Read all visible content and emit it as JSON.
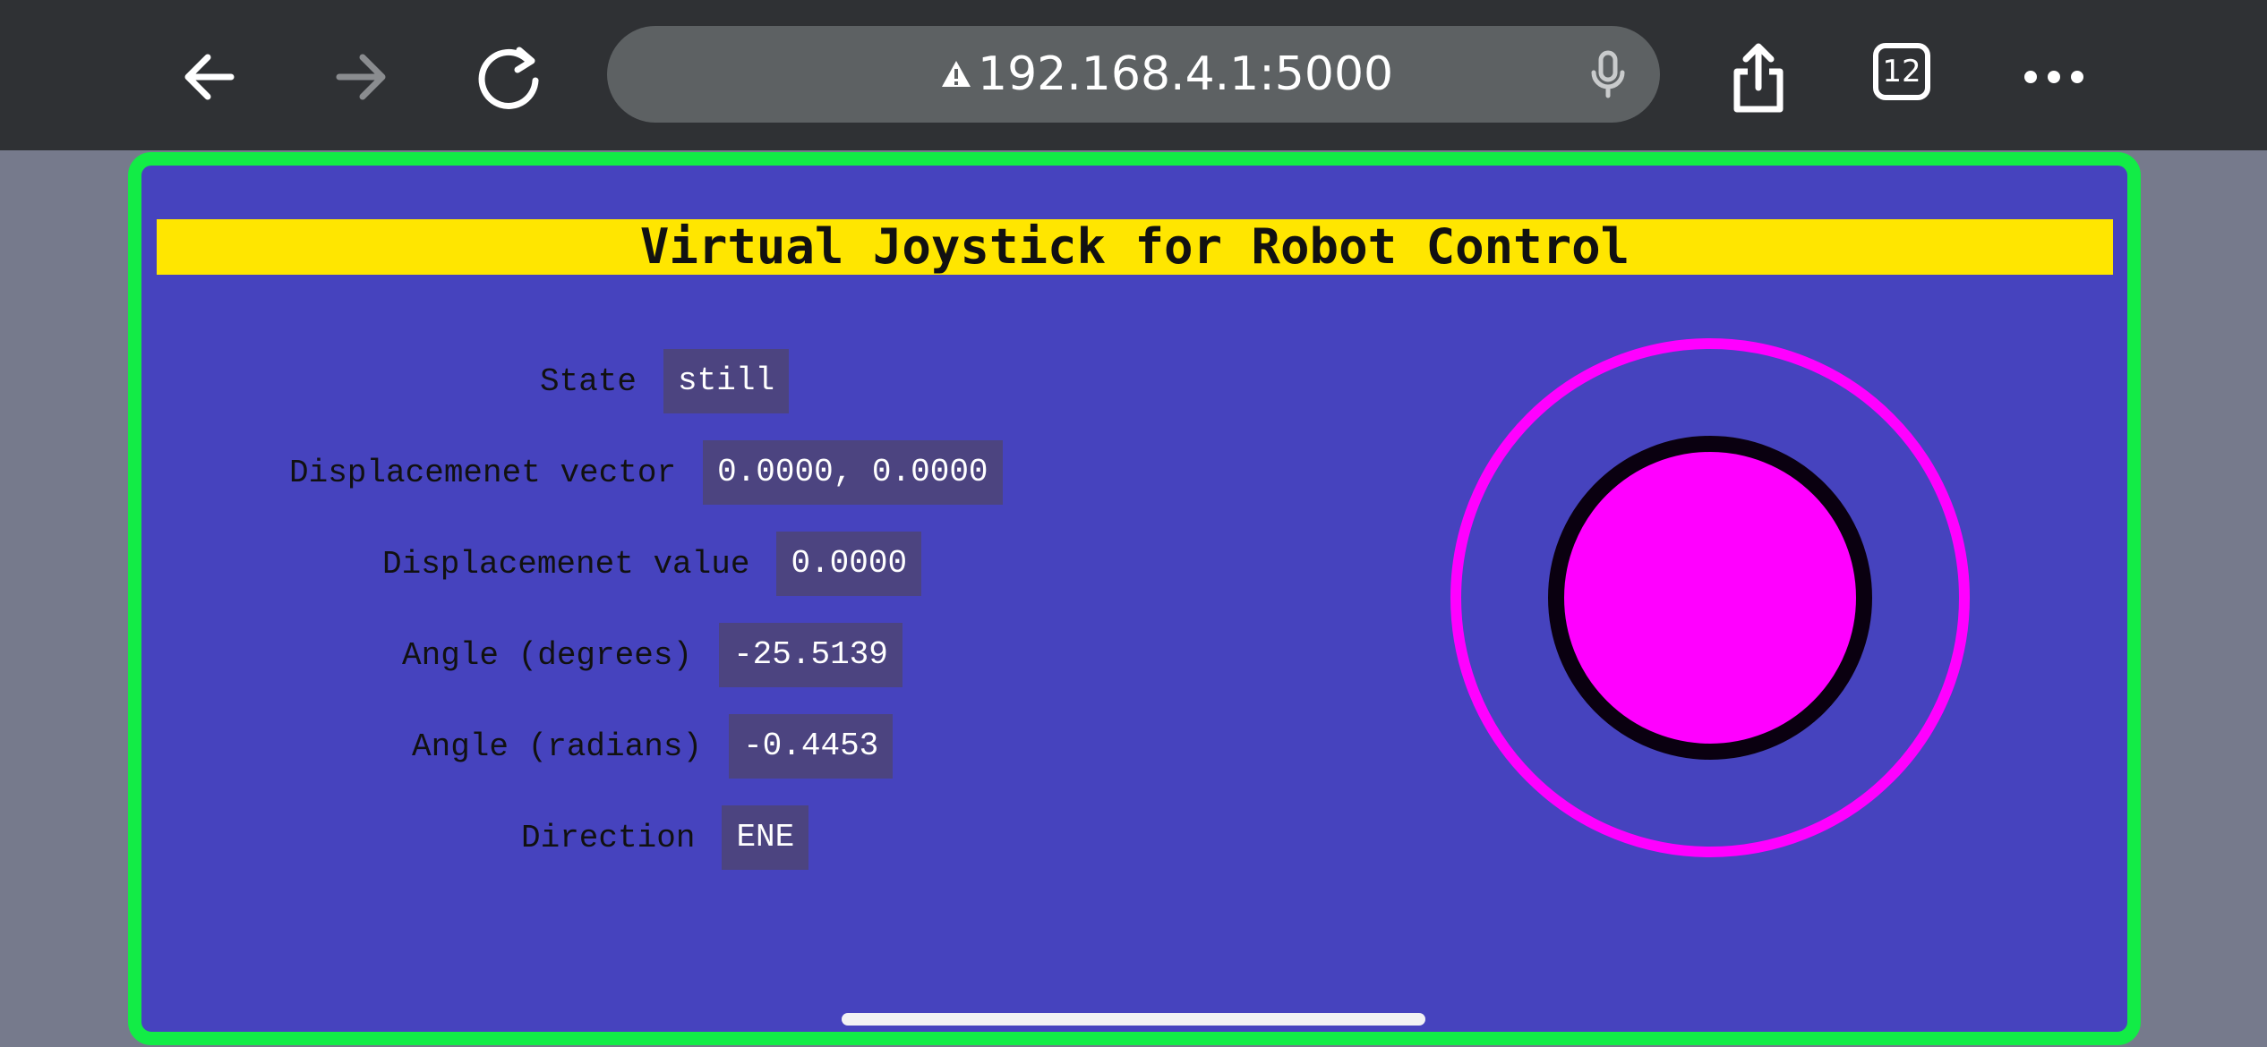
{
  "browser": {
    "url": "192.168.4.1:5000",
    "tab_count": "12",
    "icons": [
      "back-icon",
      "forward-icon",
      "reload-icon",
      "warning-icon",
      "microphone-icon",
      "share-icon",
      "tabs-icon",
      "more-icon"
    ]
  },
  "page": {
    "title": "Virtual Joystick for Robot Control",
    "rows": [
      {
        "label": "State",
        "value": "still"
      },
      {
        "label": "Displacemenet vector",
        "value": "0.0000, 0.0000"
      },
      {
        "label": "Displacemenet value",
        "value": "0.0000"
      },
      {
        "label": "Angle (degrees)",
        "value": "-25.5139"
      },
      {
        "label": "Angle (radians)",
        "value": "-0.4453"
      },
      {
        "label": "Direction",
        "value": "ENE"
      }
    ]
  },
  "colors": {
    "toolbar": "#2f3134",
    "page_background": "#4643be",
    "frame_border": "#12ec46",
    "title_banner": "#ffe600",
    "value_box": "#4c4480",
    "joystick": "#ff00ff"
  }
}
